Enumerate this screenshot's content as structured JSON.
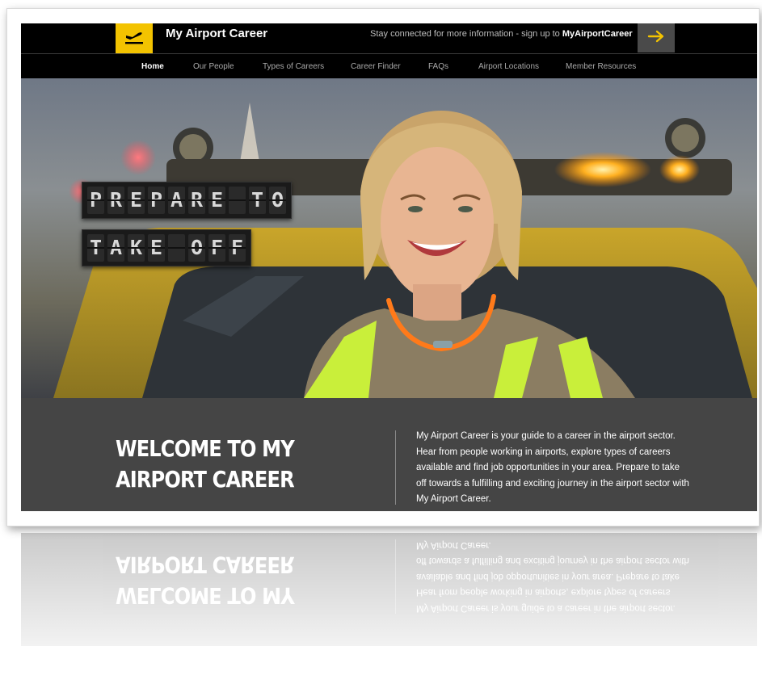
{
  "header": {
    "brand": "My Airport Career",
    "promo_text": "Stay connected for more information - sign up to ",
    "promo_link": "MyAirportCareer"
  },
  "icons": {
    "logo": "plane-takeoff-icon",
    "signup": "arrow-right-icon"
  },
  "nav": {
    "items": [
      {
        "label": "Home",
        "active": true
      },
      {
        "label": "Our People"
      },
      {
        "label": "Types of Careers"
      },
      {
        "label": "Career Finder"
      },
      {
        "label": "FAQs"
      },
      {
        "label": "Airport Locations"
      },
      {
        "label": "Member Resources"
      }
    ]
  },
  "hero": {
    "board_line1": "PREPARE TO",
    "board_line2": "TAKE OFF"
  },
  "welcome": {
    "title": "WELCOME TO MY AIRPORT CAREER",
    "body": "My Airport Career is your guide to a career in the airport sector. Hear from people working in airports, explore types of careers available and find job opportunities in your area. Prepare to take off towards a fulfilling and exciting journey in the airport sector with My Airport Career."
  },
  "colors": {
    "accent": "#f3c300",
    "bar": "#000000",
    "panel": "#454545"
  }
}
